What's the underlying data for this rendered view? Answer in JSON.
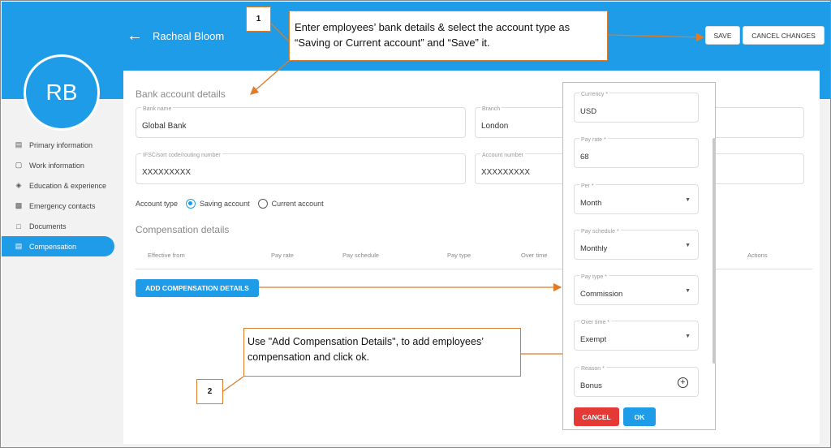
{
  "header": {
    "user_name": "Racheal Bloom",
    "avatar_initials": "RB",
    "save_label": "SAVE",
    "cancel_changes_label": "CANCEL CHANGES"
  },
  "sidebar": {
    "items": [
      {
        "label": "Primary information",
        "icon": "id-card-icon",
        "active": false
      },
      {
        "label": "Work information",
        "icon": "briefcase-icon",
        "active": false
      },
      {
        "label": "Education & experience",
        "icon": "graduation-cap-icon",
        "active": false
      },
      {
        "label": "Emergency contacts",
        "icon": "contact-card-icon",
        "active": false
      },
      {
        "label": "Documents",
        "icon": "folder-icon",
        "active": true
      },
      {
        "label": "Compensation",
        "icon": "card-icon",
        "active": true
      }
    ]
  },
  "bank": {
    "title": "Bank account details",
    "bank_name_label": "Bank name",
    "bank_name": "Global Bank",
    "branch_label": "Branch",
    "branch": "London",
    "ifsc_label": "IFSC/sort code/routing number",
    "ifsc": "XXXXXXXXX",
    "account_number_label": "Account number",
    "account_number": "XXXXXXXXX",
    "account_type_label": "Account type",
    "saving_label": "Saving account",
    "current_label": "Current account",
    "selected": "saving"
  },
  "compensation": {
    "title": "Compensation details",
    "columns": [
      "Effective from",
      "Pay rate",
      "Pay schedule",
      "Pay type",
      "Over time",
      "Actions"
    ],
    "add_button": "ADD COMPENSATION DETAILS"
  },
  "panel": {
    "fields": [
      {
        "label": "Currency *",
        "value": "USD",
        "type": "text"
      },
      {
        "label": "Pay rate *",
        "value": "68",
        "type": "text"
      },
      {
        "label": "Per *",
        "value": "Month",
        "type": "select"
      },
      {
        "label": "Pay schedule *",
        "value": "Monthly",
        "type": "select"
      },
      {
        "label": "Pay type *",
        "value": "Commission",
        "type": "select"
      },
      {
        "label": "Over time *",
        "value": "Exempt",
        "type": "select"
      },
      {
        "label": "Reason *",
        "value": "Bonus",
        "type": "add"
      }
    ],
    "cancel_label": "CANCEL",
    "ok_label": "OK"
  },
  "callouts": {
    "step1_number": "1",
    "step1_text": "Enter employees’ bank details & select the account type as “Saving or Current account” and “Save” it.",
    "step2_number": "2",
    "step2_text": "Use \"Add Compensation Details\", to add employees’ compensation and click ok."
  },
  "colors": {
    "primary": "#1e9ce8",
    "danger": "#e53935",
    "annotation": "#e07b27"
  }
}
